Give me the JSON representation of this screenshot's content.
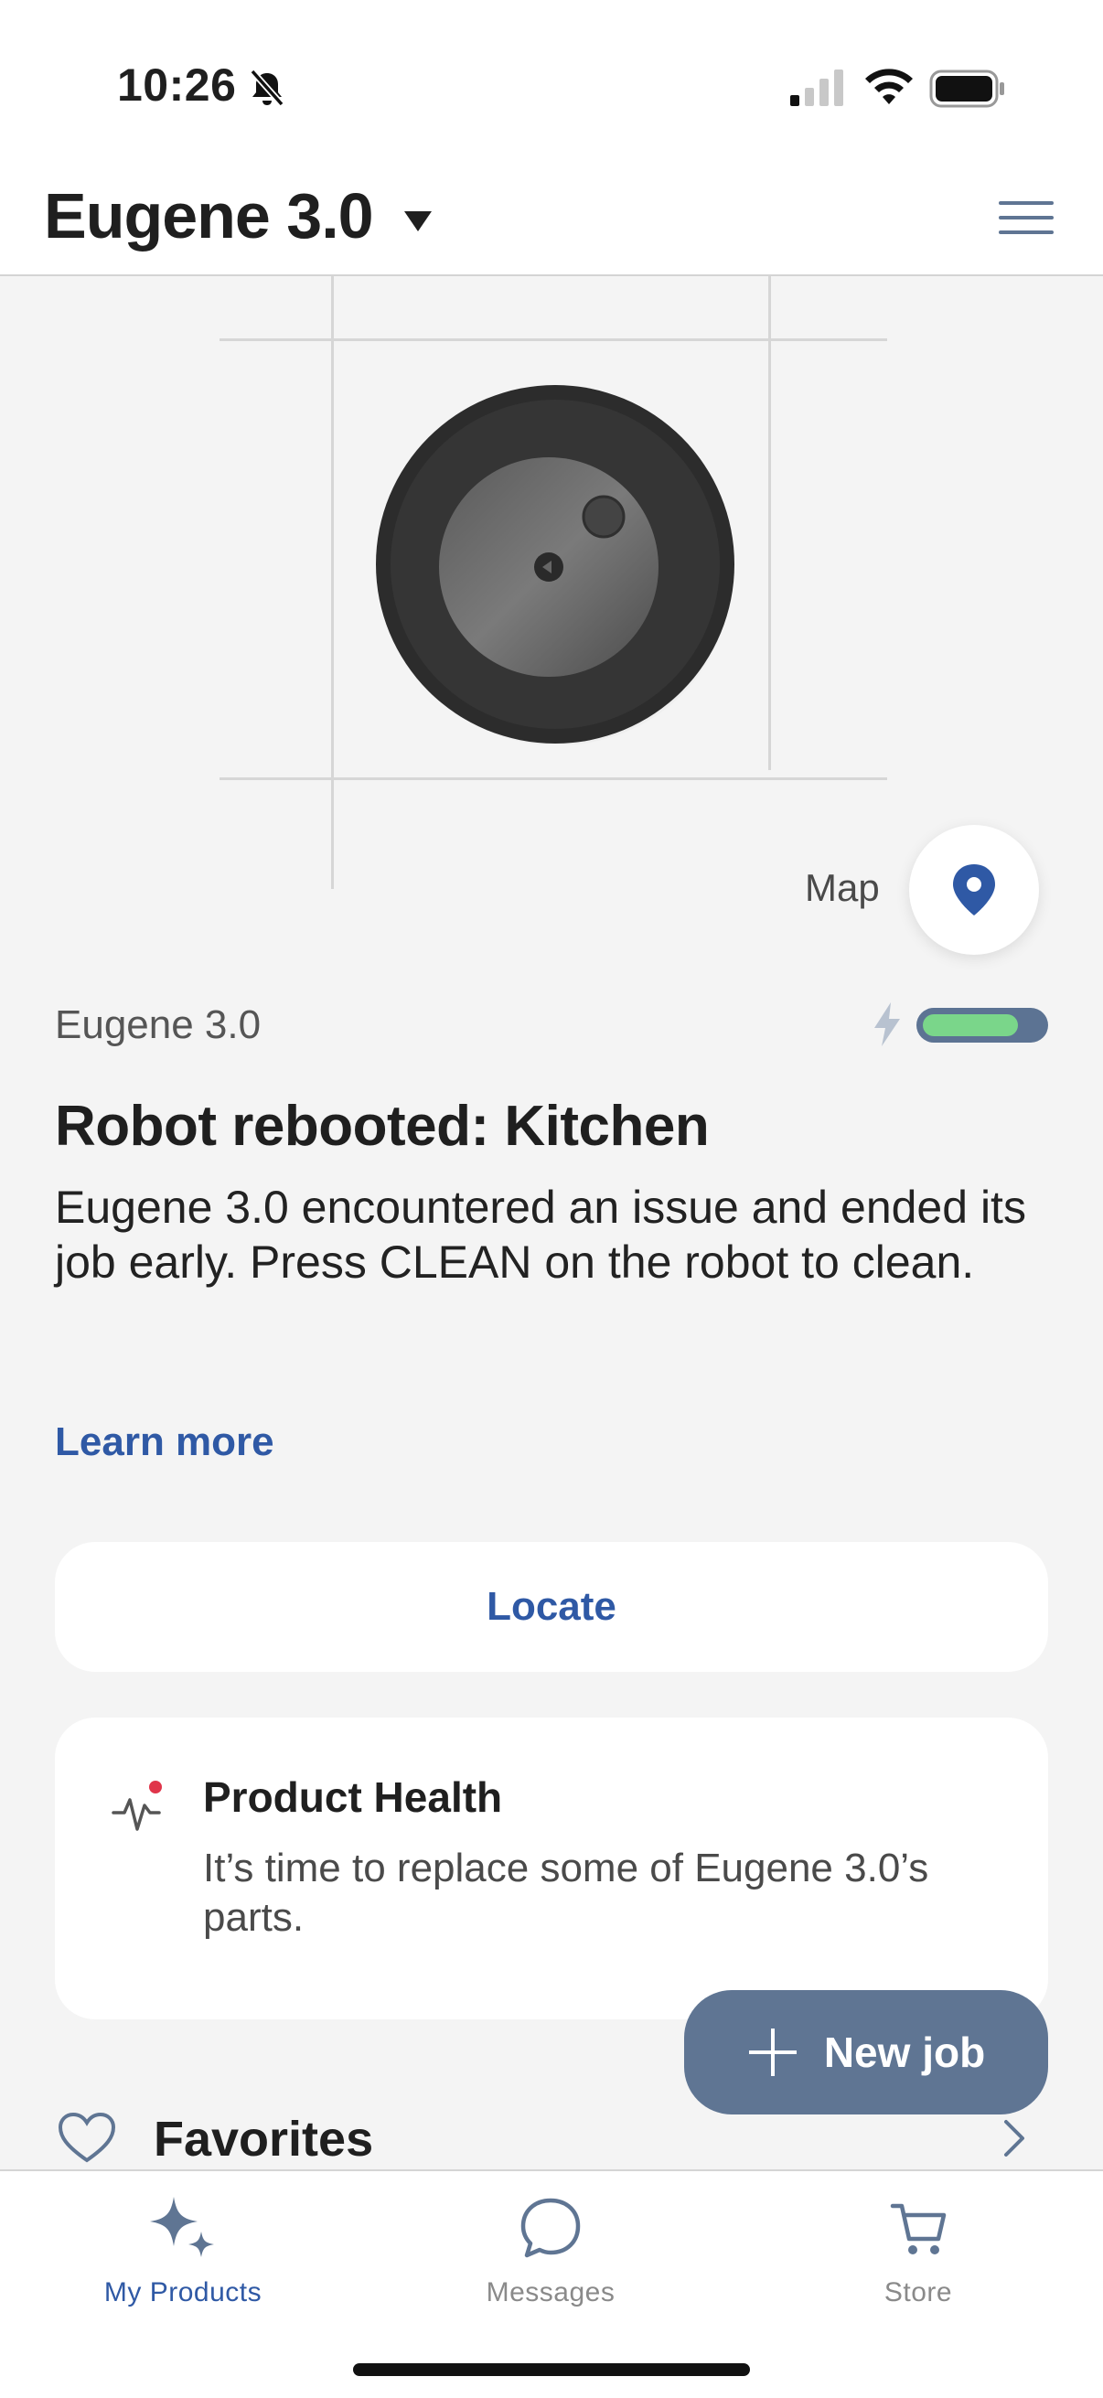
{
  "status_bar": {
    "time": "10:26",
    "icons": [
      "bell-slash-icon",
      "signal-icon",
      "wifi-icon",
      "battery-icon"
    ]
  },
  "header": {
    "title": "Eugene 3.0",
    "icons": [
      "caret-down-icon",
      "menu-icon"
    ]
  },
  "hero": {
    "map_label": "Map",
    "icons": [
      "map-pin-icon"
    ]
  },
  "robot": {
    "name": "Eugene 3.0",
    "battery_level": 0.8,
    "icons": [
      "charging-bolt-icon"
    ]
  },
  "status": {
    "title": "Robot rebooted: Kitchen",
    "message": "Eugene 3.0 encountered an issue and ended its job early. Press CLEAN on the robot to clean.",
    "learn_more": "Learn more"
  },
  "locate": {
    "label": "Locate"
  },
  "product_health": {
    "title": "Product Health",
    "description": "It’s time to replace some of Eugene 3.0’s parts.",
    "icons": [
      "health-pulse-icon"
    ]
  },
  "new_job": {
    "label": "New job",
    "icons": [
      "plus-icon"
    ]
  },
  "favorites": {
    "label": "Favorites",
    "icons": [
      "heart-icon",
      "chevron-right-icon"
    ]
  },
  "tabs": [
    {
      "label": "My Products",
      "icon": "sparkle-icon",
      "active": true
    },
    {
      "label": "Messages",
      "icon": "chat-bubble-icon",
      "active": false
    },
    {
      "label": "Store",
      "icon": "cart-icon",
      "active": false
    }
  ],
  "colors": {
    "accent": "#2f59a5",
    "new_job_button": "#5f7593",
    "battery_fill": "#7ad68a",
    "background": "#f4f4f4",
    "alert_dot": "#e0354a"
  }
}
